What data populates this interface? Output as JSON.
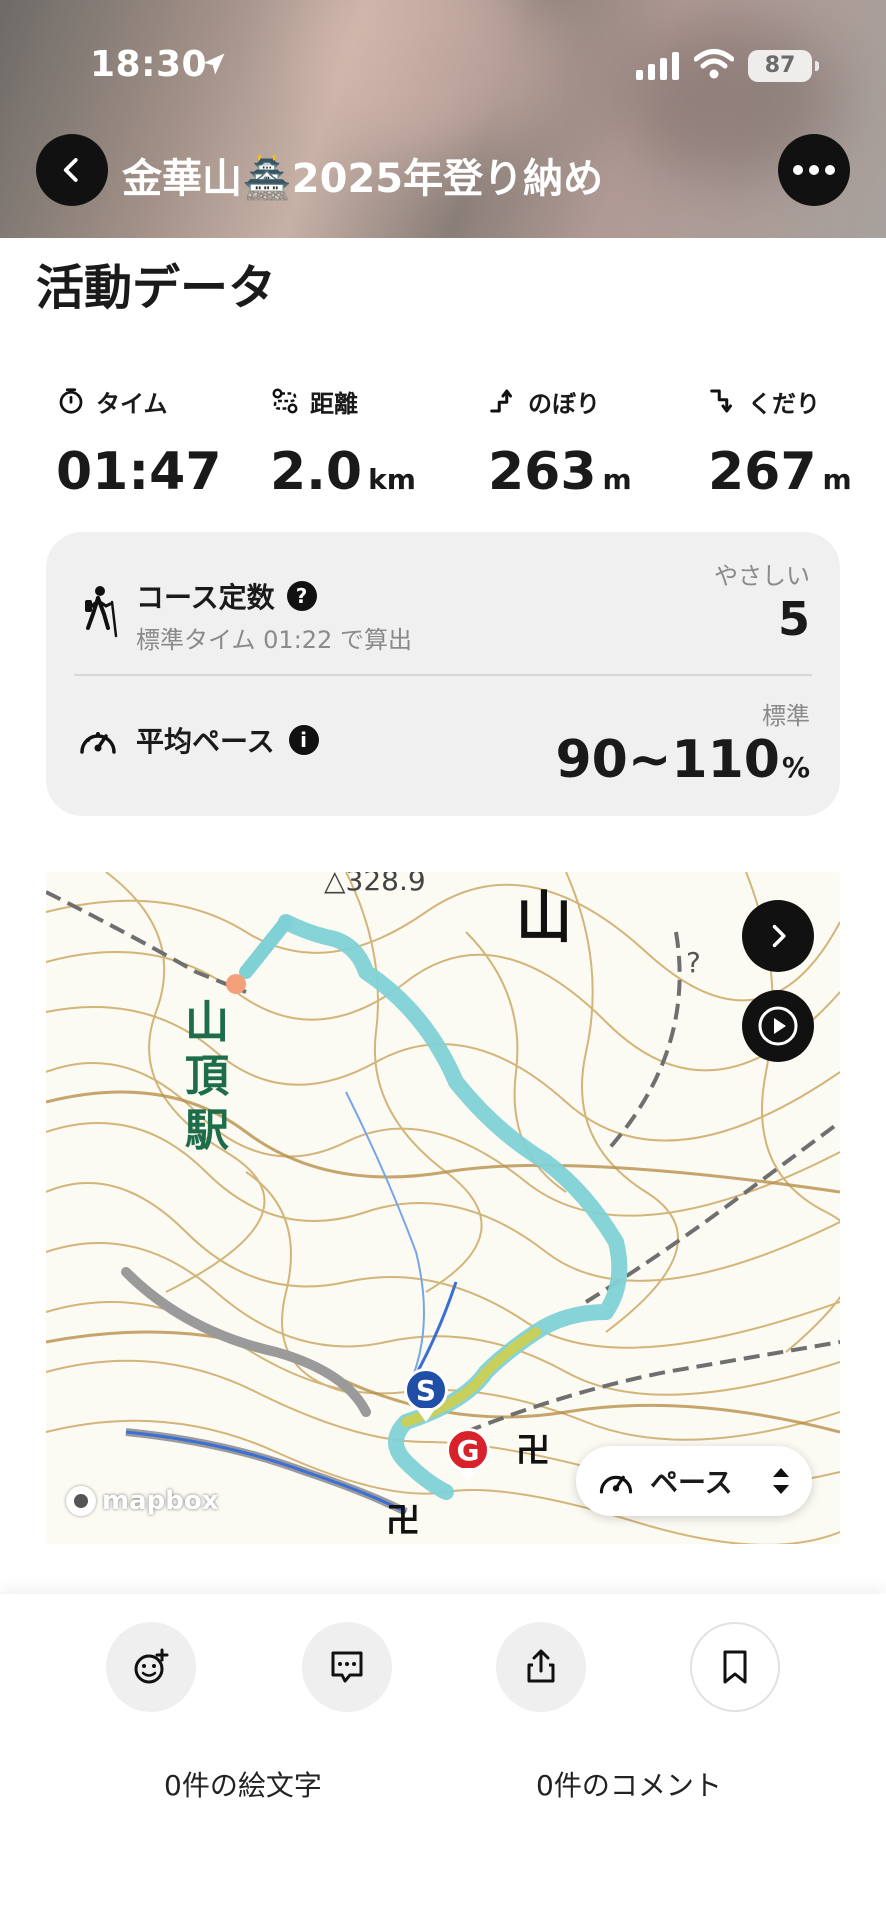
{
  "status_bar": {
    "time": "18:30",
    "battery": "87"
  },
  "header": {
    "title": "金華山🏯2025年登り納め"
  },
  "activity": {
    "section_title": "活動データ",
    "stats": [
      {
        "label": "タイム",
        "value": "01:47",
        "unit": "",
        "icon": "stopwatch-icon"
      },
      {
        "label": "距離",
        "value": "2.0",
        "unit": "km",
        "icon": "route-icon"
      },
      {
        "label": "のぼり",
        "value": "263",
        "unit": "m",
        "icon": "ascent-icon"
      },
      {
        "label": "くだり",
        "value": "267",
        "unit": "m",
        "icon": "descent-icon"
      }
    ]
  },
  "course": {
    "label": "コース定数",
    "subtext": "標準タイム 01:22 で算出",
    "difficulty": "やさしい",
    "value": "5"
  },
  "pace": {
    "label": "平均ペース",
    "level": "標準",
    "value": "90~110",
    "unit": "%"
  },
  "map": {
    "station_label": "山頂駅",
    "peak_label": "328.9",
    "start_marker": "S",
    "goal_marker": "G",
    "mode_label": "ペース",
    "attribution": "mapbox",
    "colors": {
      "route": "#7fd1d6",
      "contour": "#c7a35e",
      "start": "#1f4fa6",
      "goal": "#d8222b"
    }
  },
  "actions": {
    "emoji_count": "0件の絵文字",
    "comment_count": "0件のコメント"
  }
}
